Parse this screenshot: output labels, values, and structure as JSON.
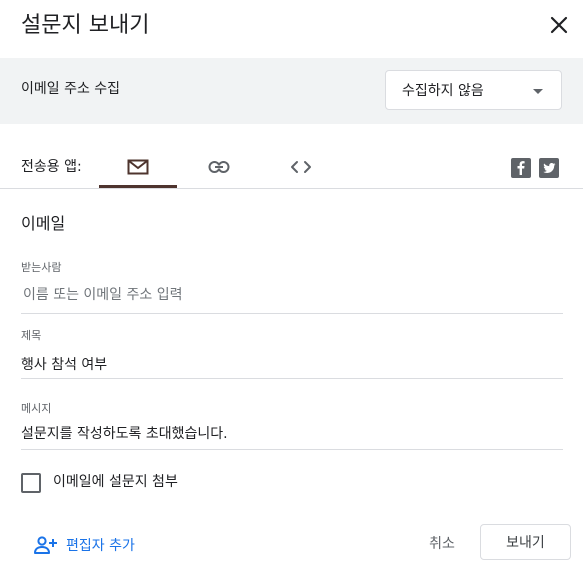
{
  "dialog": {
    "title": "설문지 보내기",
    "close_icon": "close-icon"
  },
  "collect_email": {
    "label": "이메일 주소 수집",
    "selected": "수집하지 않음"
  },
  "send_via": {
    "label": "전송용 앱:",
    "tabs": [
      {
        "name": "email",
        "icon": "mail-icon",
        "active": true
      },
      {
        "name": "link",
        "icon": "link-icon",
        "active": false
      },
      {
        "name": "embed",
        "icon": "code-icon",
        "active": false
      }
    ],
    "social": [
      "facebook-icon",
      "twitter-icon"
    ]
  },
  "email_form": {
    "section_title": "이메일",
    "to": {
      "label": "받는사람",
      "placeholder": "이름 또는 이메일 주소 입력",
      "value": ""
    },
    "subject": {
      "label": "제목",
      "value": "행사 참석 여부"
    },
    "message": {
      "label": "메시지",
      "value": "설문지를 작성하도록 초대했습니다."
    },
    "include_form": {
      "label": "이메일에 설문지 첨부",
      "checked": false
    }
  },
  "footer": {
    "add_editor": "편집자 추가",
    "cancel": "취소",
    "send": "보내기"
  },
  "colors": {
    "accent": "#1a73e8",
    "band": "#f1f3f4",
    "tab_indicator": "#4e342e"
  }
}
